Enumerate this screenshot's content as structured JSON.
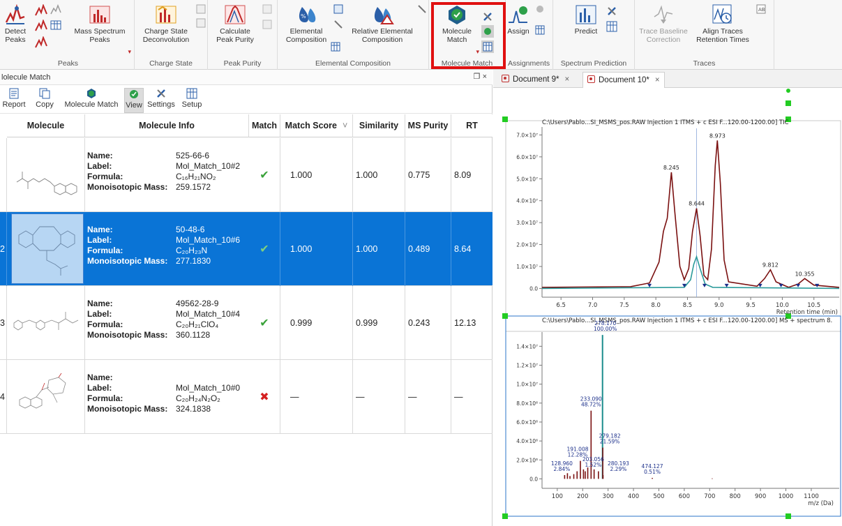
{
  "ribbon": {
    "groups": {
      "peaks": "Peaks",
      "charge_state": "Charge State",
      "peak_purity": "Peak Purity",
      "elemental_composition": "Elemental Composition",
      "molecule_match": "Molecule Match",
      "assignments": "Assignments",
      "spectrum_prediction": "Spectrum Prediction",
      "traces": "Traces"
    },
    "buttons": {
      "detect_peaks": [
        "Detect",
        "Peaks"
      ],
      "mass_spectrum_peaks": [
        "Mass Spectrum",
        "Peaks"
      ],
      "charge_state_deconvolution": [
        "Charge State",
        "Deconvolution"
      ],
      "calculate_peak_purity": [
        "Calculate",
        "Peak Purity"
      ],
      "elemental_composition": [
        "Elemental",
        "Composition"
      ],
      "relative_elemental_composition": [
        "Relative Elemental",
        "Composition"
      ],
      "molecule_match": [
        "Molecule",
        "Match"
      ],
      "assign": "Assign",
      "predict": "Predict",
      "trace_baseline_correction": [
        "Trace Baseline",
        "Correction"
      ],
      "align_traces": [
        "Align Traces",
        "Retention Times"
      ]
    }
  },
  "panel": {
    "title": "lolecule Match",
    "controls": "❐ ×",
    "toolbar": {
      "report": "Report",
      "copy": "Copy",
      "molecule_match": "Molecule Match",
      "view": "View",
      "settings": "Settings",
      "setup": "Setup"
    },
    "columns": [
      "Molecule",
      "Molecule Info",
      "Match",
      "Match Score",
      "Similarity",
      "MS Purity",
      "RT"
    ],
    "sort_indicator": "˅",
    "info_keys": {
      "name": "Name:",
      "label": "Label:",
      "formula": "Formula:",
      "mass": "Monoisotopic Mass:"
    },
    "rows": [
      {
        "index": "",
        "name": "525-66-6",
        "label": "Mol_Match_10#2",
        "formula": "C₁₆H₂₁NO₂",
        "mass": "259.1572",
        "match": "✔",
        "score": "1.000",
        "similarity": "1.000",
        "purity": "0.775",
        "rt": "8.09"
      },
      {
        "index": "2",
        "name": "50-48-6",
        "label": "Mol_Match_10#6",
        "formula": "C₂₀H₂₃N",
        "mass": "277.1830",
        "match": "✔",
        "score": "1.000",
        "similarity": "1.000",
        "purity": "0.489",
        "rt": "8.64"
      },
      {
        "index": "3",
        "name": "49562-28-9",
        "label": "Mol_Match_10#4",
        "formula": "C₂₀H₂₁ClO₄",
        "mass": "360.1128",
        "match": "✔",
        "score": "0.999",
        "similarity": "0.999",
        "purity": "0.243",
        "rt": "12.13"
      },
      {
        "index": "4",
        "name": "",
        "label": "Mol_Match_10#0",
        "formula": "C₂₀H₂₄N₂O₂",
        "mass": "324.1838",
        "match": "✖",
        "score": "—",
        "similarity": "—",
        "purity": "—",
        "rt": "—"
      }
    ]
  },
  "documents": {
    "tabs": [
      "Document 9*",
      "Document 10*"
    ],
    "close_glyph": "×"
  },
  "chart_data": [
    {
      "type": "line",
      "title": "C:\\Users\\Pablo...SI_MSMS_pos.RAW Injection 1 ITMS + c ESI F...120.00-1200.00] TIC",
      "xlabel": "Retention time (min)",
      "xlim": [
        6.2,
        10.9
      ],
      "ylim": [
        -4000000.0,
        73000000.0
      ],
      "x_ticks": [
        "6.5",
        "7.0",
        "7.5",
        "8.0",
        "8.5",
        "9.0",
        "9.5",
        "10.0",
        "10.5"
      ],
      "y_ticks": [
        "0.0",
        "1.0×10⁷",
        "2.0×10⁷",
        "3.0×10⁷",
        "4.0×10⁷",
        "5.0×10⁷",
        "6.0×10⁷",
        "7.0×10⁷"
      ],
      "peak_labels": [
        {
          "x": 8.245,
          "y": 53000000.0,
          "text": "8.245"
        },
        {
          "x": 8.644,
          "y": 36500000.0,
          "text": "8.644"
        },
        {
          "x": 8.973,
          "y": 67500000.0,
          "text": "8.973"
        },
        {
          "x": 9.812,
          "y": 8500000.0,
          "text": "9.812"
        },
        {
          "x": 10.355,
          "y": 4500000.0,
          "text": "10.355"
        }
      ],
      "series": [
        {
          "name": "TIC",
          "color": "#7a1010",
          "points": [
            [
              6.2,
              500000.0
            ],
            [
              7.6,
              800000.0
            ],
            [
              7.9,
              2500000.0
            ],
            [
              8.05,
              12000000.0
            ],
            [
              8.12,
              26000000.0
            ],
            [
              8.18,
              32000000.0
            ],
            [
              8.245,
              53000000.0
            ],
            [
              8.3,
              35000000.0
            ],
            [
              8.38,
              10000000.0
            ],
            [
              8.45,
              4000000.0
            ],
            [
              8.52,
              9000000.0
            ],
            [
              8.58,
              26000000.0
            ],
            [
              8.644,
              36500000.0
            ],
            [
              8.7,
              24000000.0
            ],
            [
              8.76,
              6000000.0
            ],
            [
              8.82,
              4000000.0
            ],
            [
              8.88,
              18000000.0
            ],
            [
              8.94,
              56000000.0
            ],
            [
              8.973,
              67500000.0
            ],
            [
              9.02,
              48000000.0
            ],
            [
              9.08,
              13000000.0
            ],
            [
              9.15,
              3000000.0
            ],
            [
              9.6,
              1000000.0
            ],
            [
              9.72,
              4500000.0
            ],
            [
              9.812,
              8500000.0
            ],
            [
              9.9,
              3000000.0
            ],
            [
              10.1,
              500000.0
            ],
            [
              10.25,
              2000000.0
            ],
            [
              10.355,
              4500000.0
            ],
            [
              10.5,
              1500000.0
            ],
            [
              10.9,
              500000.0
            ]
          ]
        },
        {
          "name": "EIC",
          "color": "#2a9a9a",
          "points": [
            [
              6.2,
              0.0
            ],
            [
              8.45,
              500000.0
            ],
            [
              8.55,
              4000000.0
            ],
            [
              8.6,
              11000000.0
            ],
            [
              8.644,
              14500000.0
            ],
            [
              8.7,
              9000000.0
            ],
            [
              8.78,
              2000000.0
            ],
            [
              8.9,
              500000.0
            ],
            [
              10.9,
              0.0
            ]
          ]
        }
      ]
    },
    {
      "type": "bar",
      "title": "C:\\Users\\Pablo...SI_MSMS_pos.RAW Injection 1 ITMS + c ESI F...120.00-1200.00] MS + spectrum 8.",
      "xlabel": "m/z (Da)",
      "xlim": [
        40,
        1210
      ],
      "ylim": [
        -1000000.0,
        15500000.0
      ],
      "x_ticks": [
        "100",
        "200",
        "300",
        "400",
        "500",
        "600",
        "700",
        "800",
        "900",
        "1000",
        "1100"
      ],
      "y_ticks": [
        "0.0",
        "2.0×10⁶",
        "4.0×10⁶",
        "6.0×10⁶",
        "8.0×10⁶",
        "1.0×10⁷",
        "1.2×10⁷",
        "1.4×10⁷"
      ],
      "bars": [
        [
          128.96,
          400000.0
        ],
        [
          140,
          600000.0
        ],
        [
          150,
          300000.0
        ],
        [
          165,
          500000.0
        ],
        [
          178,
          800000.0
        ],
        [
          191.008,
          1900000.0
        ],
        [
          203.056,
          1000000.0
        ],
        [
          210,
          800000.0
        ],
        [
          220,
          1200000.0
        ],
        [
          233.09,
          7200000.0
        ],
        [
          245,
          1000000.0
        ],
        [
          262,
          800000.0
        ],
        [
          278.17,
          15200000.0
        ],
        [
          279.182,
          3300000.0
        ],
        [
          280.193,
          400000.0
        ],
        [
          474.127,
          100000.0
        ],
        [
          710,
          50000.0
        ]
      ],
      "bar_color": "#7a1010",
      "highlight_bar": {
        "mz": 278.17,
        "color": "#1a8c8c"
      },
      "annotations": [
        {
          "mz": 278.17,
          "text": [
            "278.170",
            "100.00%"
          ]
        },
        {
          "mz": 233.09,
          "text": [
            "233.090",
            "48.72%"
          ]
        },
        {
          "mz": 279.182,
          "text": [
            "279.182",
            "21.59%"
          ]
        },
        {
          "mz": 191.008,
          "text": [
            "191.008",
            "12.28%"
          ]
        },
        {
          "mz": 128.96,
          "text": [
            "128.960",
            "2.84%"
          ]
        },
        {
          "mz": 203.056,
          "text": [
            "203.056",
            "1.52%"
          ]
        },
        {
          "mz": 280.193,
          "text": [
            "280.193",
            "2.29%"
          ]
        },
        {
          "mz": 474.127,
          "text": [
            "474.127",
            "0.51%"
          ]
        }
      ]
    }
  ]
}
